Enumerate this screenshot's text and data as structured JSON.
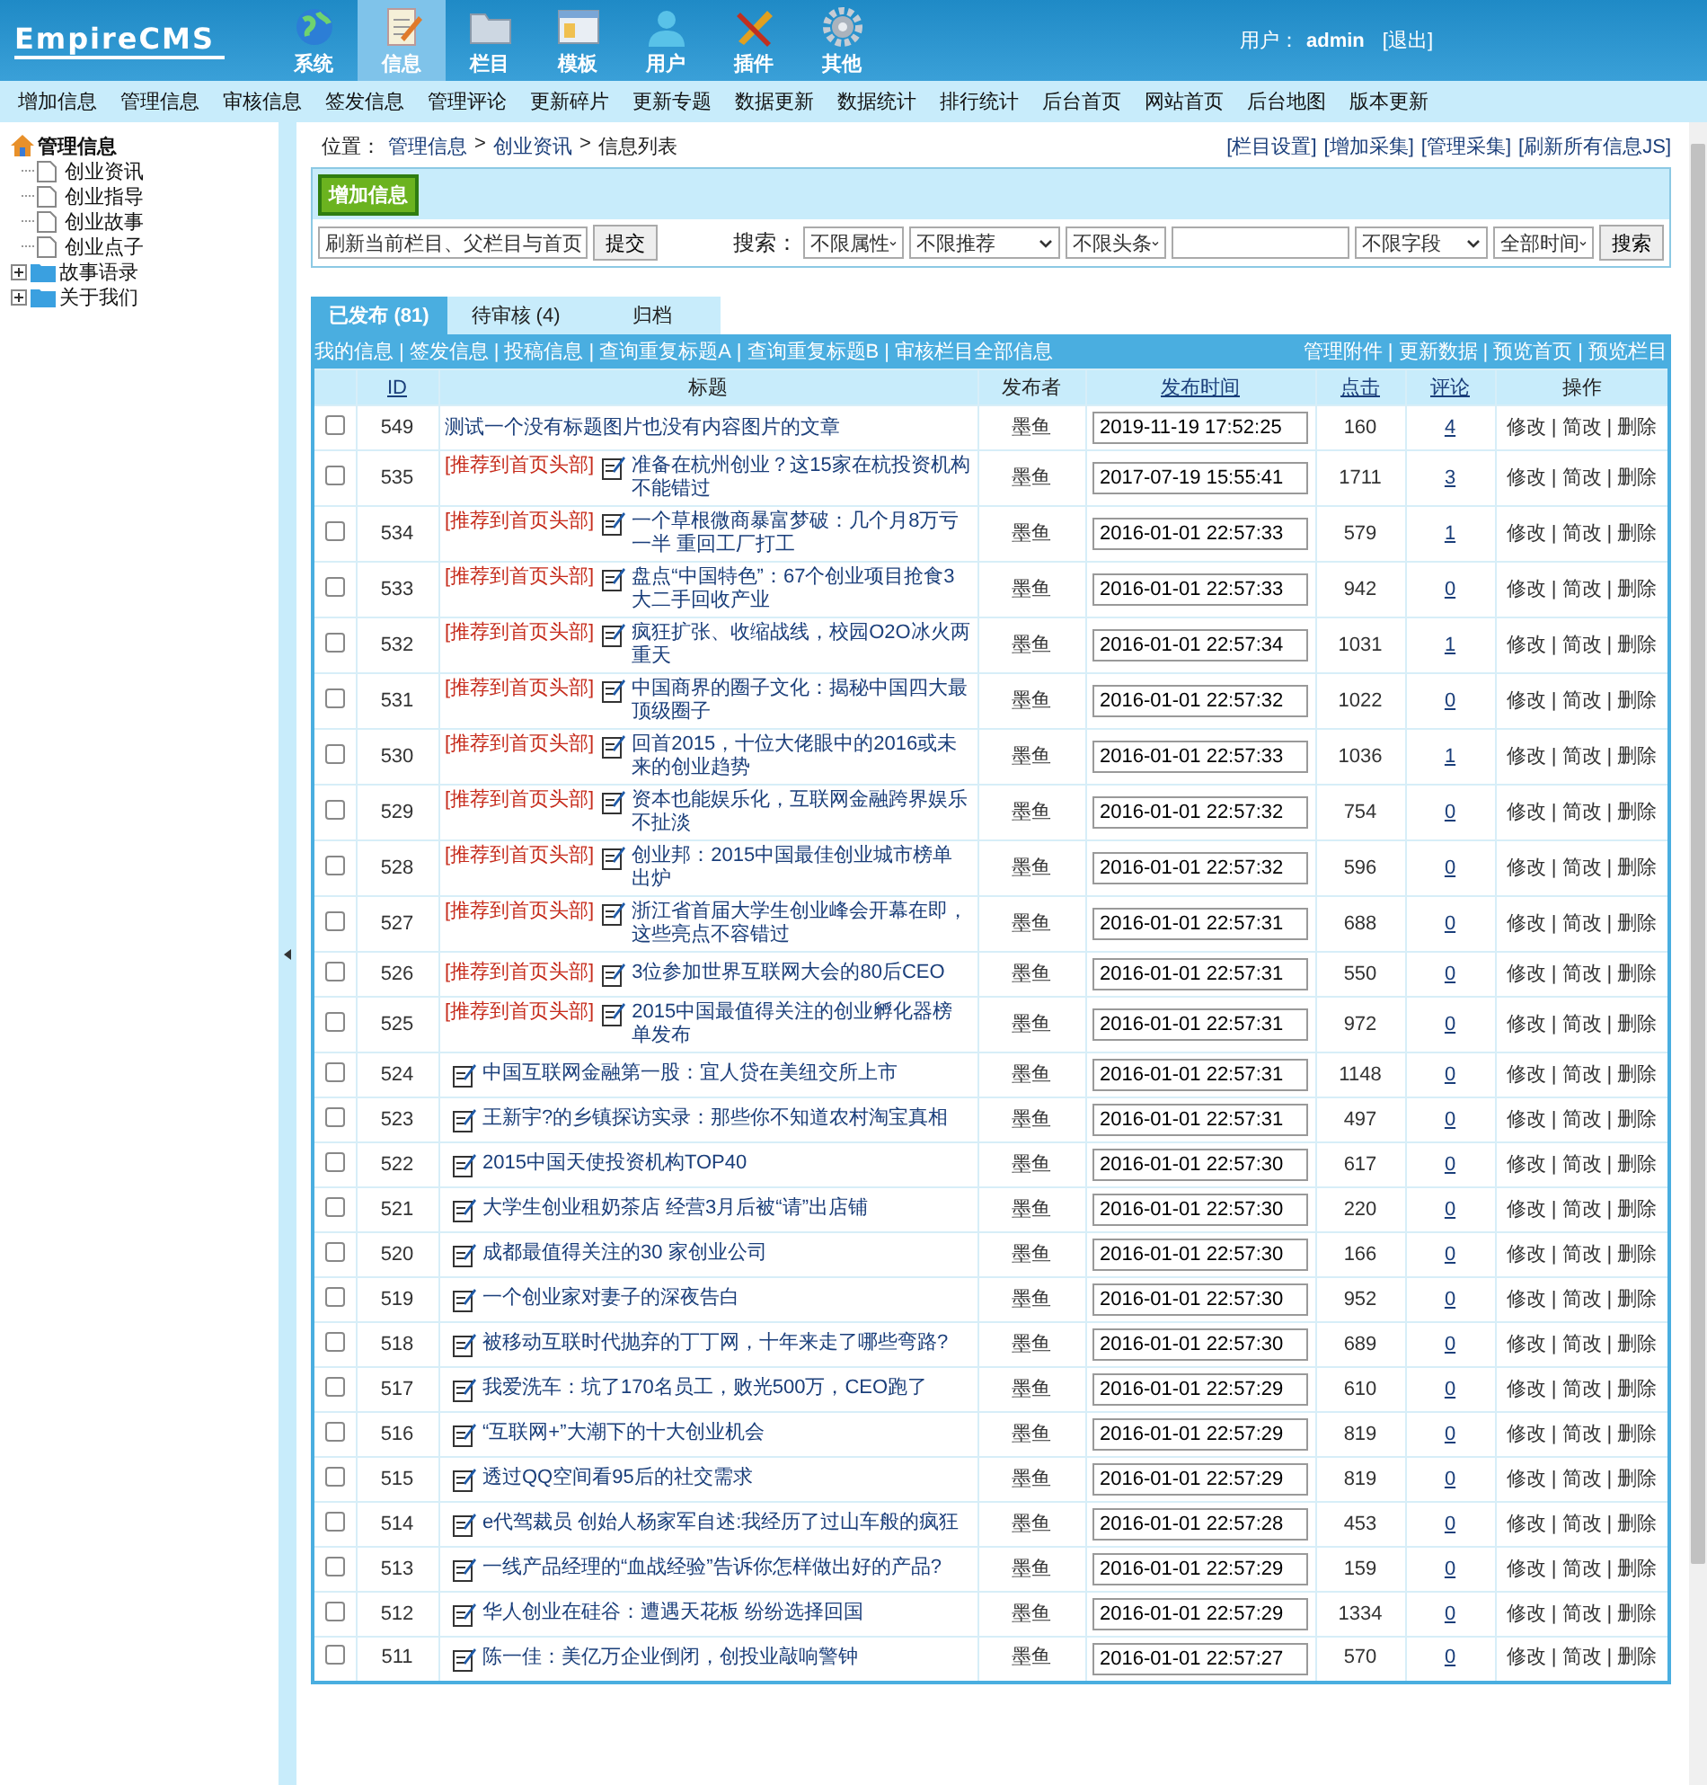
{
  "header": {
    "logo": "EmpireCMS",
    "modules": [
      {
        "label": "系统",
        "selected": false
      },
      {
        "label": "信息",
        "selected": true
      },
      {
        "label": "栏目",
        "selected": false
      },
      {
        "label": "模板",
        "selected": false
      },
      {
        "label": "用户",
        "selected": false
      },
      {
        "label": "插件",
        "selected": false
      },
      {
        "label": "其他",
        "selected": false
      }
    ],
    "user_label": "用户：",
    "user_name": "admin",
    "logout": "[退出]"
  },
  "nav": [
    "增加信息",
    "管理信息",
    "审核信息",
    "签发信息",
    "管理评论",
    "更新碎片",
    "更新专题",
    "数据更新",
    "数据统计",
    "排行统计",
    "后台首页",
    "网站首页",
    "后台地图",
    "版本更新"
  ],
  "sidebar": {
    "tree": [
      {
        "label": "管理信息",
        "kind": "root",
        "children": [
          {
            "label": "创业资讯"
          },
          {
            "label": "创业指导"
          },
          {
            "label": "创业故事"
          },
          {
            "label": "创业点子"
          }
        ]
      },
      {
        "label": "故事语录",
        "kind": "folder",
        "expanded": false
      },
      {
        "label": "关于我们",
        "kind": "folder",
        "expanded": false
      }
    ]
  },
  "breadcrumb": {
    "label": "位置：",
    "separator": ">",
    "items": [
      "管理信息",
      "创业资讯",
      "信息列表"
    ]
  },
  "top_links": [
    "[栏目设置]",
    "[增加采集]",
    "[管理采集]",
    "[刷新所有信息JS]"
  ],
  "toolbar": {
    "add_button": "增加信息",
    "refresh_select": "刷新当前栏目、父栏目与首页",
    "submit": "提交",
    "search_label": "搜索：",
    "filters_a": [
      "不限属性",
      "不限推荐",
      "不限头条"
    ],
    "filters_b": [
      "不限字段",
      "全部时间"
    ],
    "search_button": "搜索"
  },
  "tabs": [
    {
      "label": "已发布 (81)",
      "selected": true
    },
    {
      "label": "待审核 (4)",
      "selected": false
    },
    {
      "label": "归档",
      "selected": false
    }
  ],
  "link_bar": {
    "separator": "|",
    "left": [
      "我的信息",
      "签发信息",
      "投稿信息",
      "查询重复标题A",
      "查询重复标题B",
      "审核栏目全部信息"
    ],
    "right": [
      "管理附件",
      "更新数据",
      "预览首页",
      "预览栏目"
    ]
  },
  "table": {
    "columns": [
      {
        "label": "ID",
        "sortable": true
      },
      {
        "label": "标题",
        "sortable": false
      },
      {
        "label": "发布者",
        "sortable": false
      },
      {
        "label": "发布时间",
        "sortable": true
      },
      {
        "label": "点击",
        "sortable": true
      },
      {
        "label": "评论",
        "sortable": true
      },
      {
        "label": "操作",
        "sortable": false
      }
    ],
    "action_separator": "|",
    "rows": [
      {
        "checked": false,
        "id": "549",
        "kind": "plain",
        "title": "测试一个没有标题图片也没有内容图片的文章",
        "publisher": "墨鱼",
        "time": "2019-11-19 17:52:25",
        "clicks": "160",
        "comments": "4",
        "actions": [
          "修改",
          "简改",
          "删除"
        ]
      },
      {
        "checked": false,
        "id": "535",
        "kind": "tagged",
        "tag": "[推荐到首页头部]",
        "title": "准备在杭州创业？这15家在杭投资机构不能错过",
        "publisher": "墨鱼",
        "time": "2017-07-19 15:55:41",
        "clicks": "1711",
        "comments": "3",
        "actions": [
          "修改",
          "简改",
          "删除"
        ]
      },
      {
        "checked": false,
        "id": "534",
        "kind": "tagged",
        "tag": "[推荐到首页头部]",
        "title": "一个草根微商暴富梦破：几个月8万亏一半 重回工厂打工",
        "publisher": "墨鱼",
        "time": "2016-01-01 22:57:33",
        "clicks": "579",
        "comments": "1",
        "actions": [
          "修改",
          "简改",
          "删除"
        ]
      },
      {
        "checked": false,
        "id": "533",
        "kind": "tagged",
        "tag": "[推荐到首页头部]",
        "title": "盘点“中国特色”：67个创业项目抢食3大二手回收产业",
        "publisher": "墨鱼",
        "time": "2016-01-01 22:57:33",
        "clicks": "942",
        "comments": "0",
        "actions": [
          "修改",
          "简改",
          "删除"
        ]
      },
      {
        "checked": false,
        "id": "532",
        "kind": "tagged",
        "tag": "[推荐到首页头部]",
        "title": "疯狂扩张、收缩战线，校园O2O冰火两重天",
        "publisher": "墨鱼",
        "time": "2016-01-01 22:57:34",
        "clicks": "1031",
        "comments": "1",
        "actions": [
          "修改",
          "简改",
          "删除"
        ]
      },
      {
        "checked": false,
        "id": "531",
        "kind": "tagged",
        "tag": "[推荐到首页头部]",
        "title": "中国商界的圈子文化：揭秘中国四大最顶级圈子",
        "publisher": "墨鱼",
        "time": "2016-01-01 22:57:32",
        "clicks": "1022",
        "comments": "0",
        "actions": [
          "修改",
          "简改",
          "删除"
        ]
      },
      {
        "checked": false,
        "id": "530",
        "kind": "tagged",
        "tag": "[推荐到首页头部]",
        "title": "回首2015，十位大佬眼中的2016或未来的创业趋势",
        "publisher": "墨鱼",
        "time": "2016-01-01 22:57:33",
        "clicks": "1036",
        "comments": "1",
        "actions": [
          "修改",
          "简改",
          "删除"
        ]
      },
      {
        "checked": false,
        "id": "529",
        "kind": "tagged",
        "tag": "[推荐到首页头部]",
        "title": "资本也能娱乐化，互联网金融跨界娱乐不扯淡",
        "publisher": "墨鱼",
        "time": "2016-01-01 22:57:32",
        "clicks": "754",
        "comments": "0",
        "actions": [
          "修改",
          "简改",
          "删除"
        ]
      },
      {
        "checked": false,
        "id": "528",
        "kind": "tagged",
        "tag": "[推荐到首页头部]",
        "title": "创业邦：2015中国最佳创业城市榜单出炉",
        "publisher": "墨鱼",
        "time": "2016-01-01 22:57:32",
        "clicks": "596",
        "comments": "0",
        "actions": [
          "修改",
          "简改",
          "删除"
        ]
      },
      {
        "checked": false,
        "id": "527",
        "kind": "tagged",
        "tag": "[推荐到首页头部]",
        "title": "浙江省首届大学生创业峰会开幕在即，这些亮点不容错过",
        "publisher": "墨鱼",
        "time": "2016-01-01 22:57:31",
        "clicks": "688",
        "comments": "0",
        "actions": [
          "修改",
          "简改",
          "删除"
        ]
      },
      {
        "checked": false,
        "id": "526",
        "kind": "tagged",
        "tag": "[推荐到首页头部]",
        "title": "3位参加世界互联网大会的80后CEO",
        "publisher": "墨鱼",
        "time": "2016-01-01 22:57:31",
        "clicks": "550",
        "comments": "0",
        "actions": [
          "修改",
          "简改",
          "删除"
        ]
      },
      {
        "checked": false,
        "id": "525",
        "kind": "tagged",
        "tag": "[推荐到首页头部]",
        "title": "2015中国最值得关注的创业孵化器榜单发布",
        "publisher": "墨鱼",
        "time": "2016-01-01 22:57:31",
        "clicks": "972",
        "comments": "0",
        "actions": [
          "修改",
          "简改",
          "删除"
        ]
      },
      {
        "checked": false,
        "id": "524",
        "kind": "icon",
        "title": "中国互联网金融第一股：宜人贷在美纽交所上市",
        "publisher": "墨鱼",
        "time": "2016-01-01 22:57:31",
        "clicks": "1148",
        "comments": "0",
        "actions": [
          "修改",
          "简改",
          "删除"
        ]
      },
      {
        "checked": false,
        "id": "523",
        "kind": "icon",
        "title": "王新宇?的乡镇探访实录：那些你不知道农村淘宝真相",
        "publisher": "墨鱼",
        "time": "2016-01-01 22:57:31",
        "clicks": "497",
        "comments": "0",
        "actions": [
          "修改",
          "简改",
          "删除"
        ]
      },
      {
        "checked": false,
        "id": "522",
        "kind": "icon",
        "title": "2015中国天使投资机构TOP40",
        "publisher": "墨鱼",
        "time": "2016-01-01 22:57:30",
        "clicks": "617",
        "comments": "0",
        "actions": [
          "修改",
          "简改",
          "删除"
        ]
      },
      {
        "checked": false,
        "id": "521",
        "kind": "icon",
        "title": "大学生创业租奶茶店 经营3月后被“请”出店铺",
        "publisher": "墨鱼",
        "time": "2016-01-01 22:57:30",
        "clicks": "220",
        "comments": "0",
        "actions": [
          "修改",
          "简改",
          "删除"
        ]
      },
      {
        "checked": false,
        "id": "520",
        "kind": "icon",
        "title": "成都最值得关注的30 家创业公司",
        "publisher": "墨鱼",
        "time": "2016-01-01 22:57:30",
        "clicks": "166",
        "comments": "0",
        "actions": [
          "修改",
          "简改",
          "删除"
        ]
      },
      {
        "checked": false,
        "id": "519",
        "kind": "icon",
        "title": "一个创业家对妻子的深夜告白",
        "publisher": "墨鱼",
        "time": "2016-01-01 22:57:30",
        "clicks": "952",
        "comments": "0",
        "actions": [
          "修改",
          "简改",
          "删除"
        ]
      },
      {
        "checked": false,
        "id": "518",
        "kind": "icon",
        "title": "被移动互联时代抛弃的丁丁网，十年来走了哪些弯路?",
        "publisher": "墨鱼",
        "time": "2016-01-01 22:57:30",
        "clicks": "689",
        "comments": "0",
        "actions": [
          "修改",
          "简改",
          "删除"
        ]
      },
      {
        "checked": false,
        "id": "517",
        "kind": "icon",
        "title": "我爱洗车：坑了170名员工，败光500万，CEO跑了",
        "publisher": "墨鱼",
        "time": "2016-01-01 22:57:29",
        "clicks": "610",
        "comments": "0",
        "actions": [
          "修改",
          "简改",
          "删除"
        ]
      },
      {
        "checked": false,
        "id": "516",
        "kind": "icon",
        "title": "“互联网+”大潮下的十大创业机会",
        "publisher": "墨鱼",
        "time": "2016-01-01 22:57:29",
        "clicks": "819",
        "comments": "0",
        "actions": [
          "修改",
          "简改",
          "删除"
        ]
      },
      {
        "checked": false,
        "id": "515",
        "kind": "icon",
        "title": "透过QQ空间看95后的社交需求",
        "publisher": "墨鱼",
        "time": "2016-01-01 22:57:29",
        "clicks": "819",
        "comments": "0",
        "actions": [
          "修改",
          "简改",
          "删除"
        ]
      },
      {
        "checked": false,
        "id": "514",
        "kind": "icon",
        "title": "e代驾裁员 创始人杨家军自述:我经历了过山车般的疯狂",
        "publisher": "墨鱼",
        "time": "2016-01-01 22:57:28",
        "clicks": "453",
        "comments": "0",
        "actions": [
          "修改",
          "简改",
          "删除"
        ]
      },
      {
        "checked": false,
        "id": "513",
        "kind": "icon",
        "title": "一线产品经理的“血战经验”告诉你怎样做出好的产品?",
        "publisher": "墨鱼",
        "time": "2016-01-01 22:57:29",
        "clicks": "159",
        "comments": "0",
        "actions": [
          "修改",
          "简改",
          "删除"
        ]
      },
      {
        "checked": false,
        "id": "512",
        "kind": "icon",
        "title": "华人创业在硅谷：遭遇天花板 纷纷选择回国",
        "publisher": "墨鱼",
        "time": "2016-01-01 22:57:29",
        "clicks": "1334",
        "comments": "0",
        "actions": [
          "修改",
          "简改",
          "删除"
        ]
      },
      {
        "checked": false,
        "id": "511",
        "kind": "icon",
        "title": "陈一佳：美亿万企业倒闭，创投业敲响警钟",
        "publisher": "墨鱼",
        "time": "2016-01-01 22:57:27",
        "clicks": "570",
        "comments": "0",
        "actions": [
          "修改",
          "简改",
          "删除"
        ]
      }
    ]
  }
}
